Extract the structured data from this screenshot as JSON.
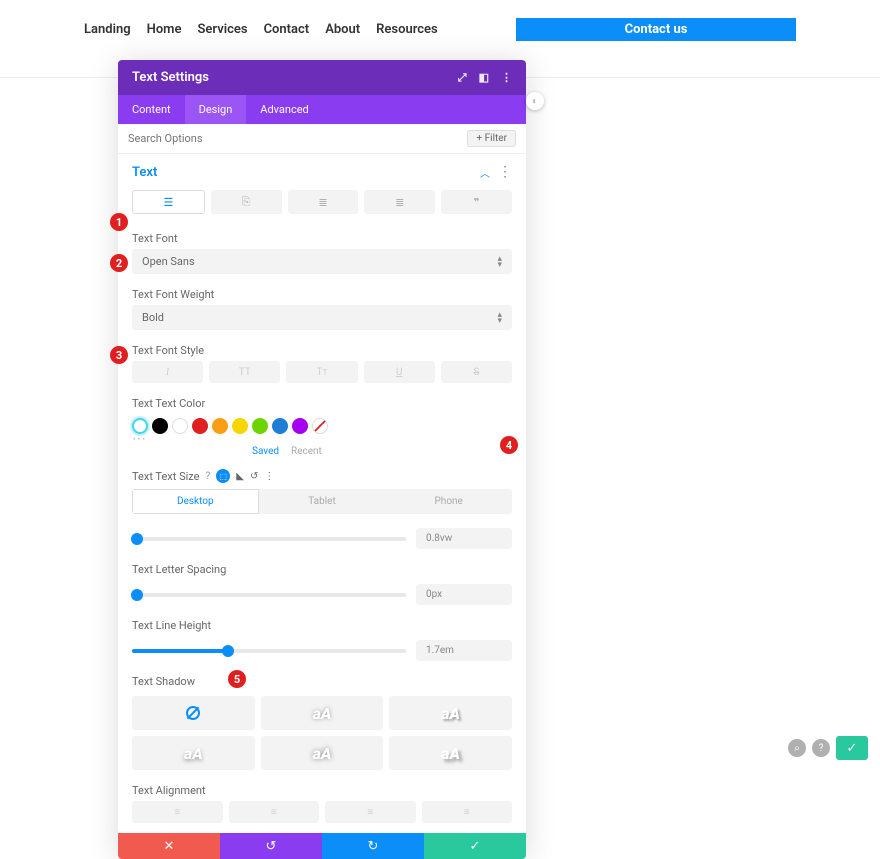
{
  "nav": {
    "items": [
      "Landing",
      "Home",
      "Services",
      "Contact",
      "About",
      "Resources"
    ],
    "cta": "Contact us"
  },
  "modal": {
    "title": "Text Settings",
    "tabs": [
      "Content",
      "Design",
      "Advanced"
    ],
    "search_placeholder": "Search Options",
    "filter_label": "Filter",
    "section_title": "Text",
    "labels": {
      "font": "Text Font",
      "weight": "Text Font Weight",
      "style": "Text Font Style",
      "color": "Text Text Color",
      "size": "Text Text Size",
      "spacing": "Text Letter Spacing",
      "lineheight": "Text Line Height",
      "shadow": "Text Shadow",
      "alignment": "Text Alignment"
    },
    "font_value": "Open Sans",
    "weight_value": "Bold",
    "saved": "Saved",
    "recent": "Recent",
    "question": "?",
    "device_tabs": [
      "Desktop",
      "Tablet",
      "Phone"
    ],
    "size_value": "0.8vw",
    "spacing_value": "0px",
    "lineheight_value": "1.7em",
    "shadow_sample": "aA"
  },
  "markers": {
    "m1": "1",
    "m2": "2",
    "m3": "3",
    "m4": "4",
    "m5": "5"
  }
}
